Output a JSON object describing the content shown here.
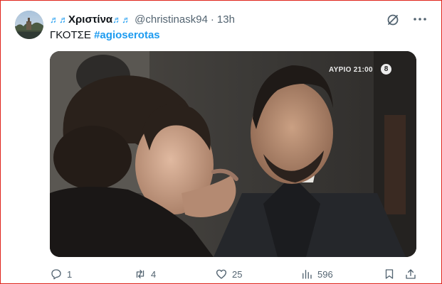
{
  "tweet": {
    "display_name": "Χριστίνα",
    "name_note_left": "♬♬",
    "name_note_right": "♬♬",
    "handle": "@christinask94",
    "separator": "·",
    "time": "13h",
    "text_plain": "ΓΚΟΤΣΕ",
    "hashtag": "#agioserotas",
    "avatar_icon": "avatar-photo",
    "media": {
      "badge_text": "ΑΥΡΙΟ 21:00",
      "badge_rating": "8",
      "icon": "video-still"
    }
  },
  "actions": {
    "reply_count": "1",
    "retweet_count": "4",
    "like_count": "25",
    "views_count": "596",
    "icons": [
      "reply-icon",
      "retweet-icon",
      "like-icon",
      "views-icon",
      "bookmark-icon",
      "share-icon"
    ]
  },
  "colors": {
    "accent": "#1d9bf0",
    "muted": "#536471",
    "frame": "#e0241b"
  }
}
